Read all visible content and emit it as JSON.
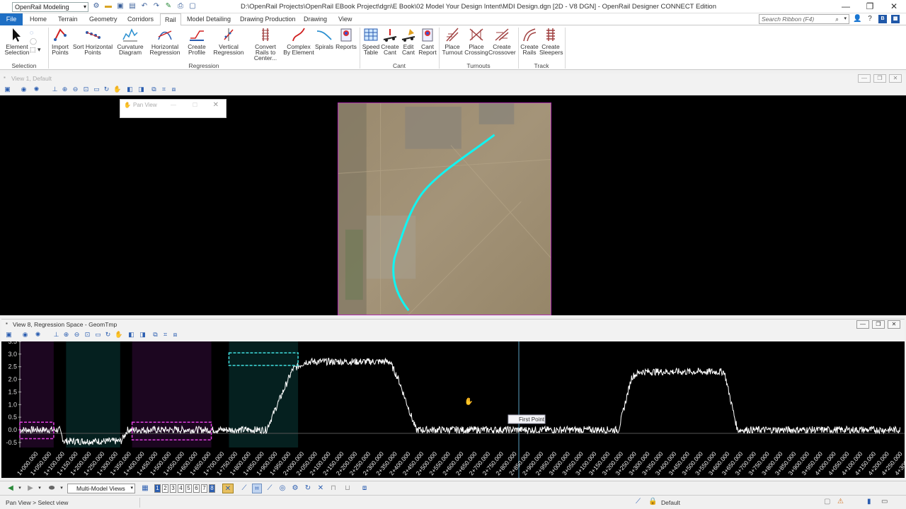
{
  "app": {
    "workspace": "OpenRail Modeling",
    "title": "D:\\OpenRail Projects\\OpenRail EBook Project\\dgn\\E Book\\02 Model Your Design Intent\\MDI Design.dgn [2D - V8 DGN] - OpenRail Designer CONNECT Edition",
    "search_placeholder": "Search Ribbon (F4)"
  },
  "tabs": [
    "File",
    "Home",
    "Terrain",
    "Geometry",
    "Corridors",
    "Rail",
    "Model Detailing",
    "Drawing Production",
    "Drawing",
    "View"
  ],
  "active_tab": "Rail",
  "ribbon": {
    "selection": {
      "label": "Selection",
      "element_selection": "Element Selection"
    },
    "regression": {
      "label": "Regression",
      "import_points": "Import Points",
      "sort_points": "Sort Horizontal Points",
      "curvature_diagram": "Curvature Diagram",
      "horizontal_regression": "Horizontal Regression",
      "create_profile": "Create Profile",
      "vertical_regression": "Vertical Regression",
      "convert_rails": "Convert Rails to Center...",
      "complex_by_element": "Complex By Element",
      "spirals": "Spirals",
      "reports": "Reports"
    },
    "cant": {
      "label": "Cant",
      "speed_table": "Speed Table",
      "create_cant": "Create Cant",
      "edit_cant": "Edit Cant",
      "cant_report": "Cant Report"
    },
    "turnouts": {
      "label": "Turnouts",
      "place_turnout": "Place Turnout",
      "place_crossing": "Place Crossing",
      "create_crossover": "Create Crossover"
    },
    "track": {
      "label": "Track",
      "create_rails": "Create Rails",
      "create_sleepers": "Create Sleepers"
    }
  },
  "view1": {
    "title": "View 1, Default",
    "pan_view_title": "Pan View"
  },
  "view8": {
    "title": "View 8, Regression Space - GeomTmp",
    "first_point_label": "First Point"
  },
  "chart_data": {
    "type": "line",
    "title": "",
    "xlabel": "",
    "ylabel": "",
    "y_ticks": [
      "3.5",
      "3.0",
      "2.5",
      "2.0",
      "1.5",
      "1.0",
      "0.5",
      "0.0",
      "-0.5"
    ],
    "ylim": [
      -0.7,
      3.5
    ],
    "x_tick_labels": [
      "1+000.000",
      "1+050.000",
      "1+100.000",
      "1+150.000",
      "1+200.000",
      "1+250.000",
      "1+300.000",
      "1+350.000",
      "1+400.000",
      "1+450.000",
      "1+500.000",
      "1+550.000",
      "1+600.000",
      "1+650.000",
      "1+700.000",
      "1+750.000",
      "1+800.000",
      "1+850.000",
      "1+900.000",
      "1+950.000",
      "2+000.000",
      "2+050.000",
      "2+100.000",
      "2+150.000",
      "2+200.000",
      "2+250.000",
      "2+300.000",
      "2+350.000",
      "2+400.000",
      "2+450.000",
      "2+500.000",
      "2+550.000",
      "2+600.000",
      "2+650.000",
      "2+700.000",
      "2+750.000",
      "2+800.000",
      "2+850.000",
      "2+900.000",
      "2+950.000",
      "3+000.000",
      "3+050.000",
      "3+100.000",
      "3+150.000",
      "3+200.000",
      "3+250.000",
      "3+300.000",
      "3+350.000",
      "3+400.000",
      "3+450.000",
      "3+500.000",
      "3+550.000",
      "3+600.000",
      "3+650.000",
      "3+700.000",
      "3+750.000",
      "3+800.000",
      "3+850.000",
      "3+900.000",
      "3+950.000",
      "4+000.000",
      "4+050.000",
      "4+100.000",
      "4+150.000",
      "4+200.000",
      "4+250.000",
      "4+300.000"
    ],
    "curve_profile": [
      [
        1000,
        0.0
      ],
      [
        1090,
        0.0
      ],
      [
        1100,
        -0.45
      ],
      [
        1230,
        -0.45
      ],
      [
        1245,
        0.0
      ],
      [
        1560,
        0.0
      ],
      [
        1620,
        2.4
      ],
      [
        1650,
        2.7
      ],
      [
        1840,
        2.7
      ],
      [
        1860,
        2.0
      ],
      [
        1900,
        0.0
      ],
      [
        2360,
        0.0
      ],
      [
        2390,
        2.1
      ],
      [
        2410,
        2.3
      ],
      [
        2600,
        2.3
      ],
      [
        2630,
        0.0
      ],
      [
        3000,
        0.0
      ]
    ],
    "regions": [
      {
        "x0": 1000,
        "x1": 1077,
        "kind": "magenta"
      },
      {
        "x0": 1105,
        "x1": 1228,
        "kind": "cyan"
      },
      {
        "x0": 1255,
        "x1": 1435,
        "kind": "magenta"
      },
      {
        "x0": 1475,
        "x1": 1632,
        "kind": "cyan"
      }
    ],
    "boxes": [
      {
        "x0": 1000,
        "x1": 1077,
        "y0": -0.35,
        "y1": 0.3,
        "color": "#e040e0"
      },
      {
        "x0": 1255,
        "x1": 1435,
        "y0": -0.4,
        "y1": 0.3,
        "color": "#e040e0"
      },
      {
        "x0": 1475,
        "x1": 1632,
        "y0": 2.55,
        "y1": 3.05,
        "color": "#40e0e0"
      }
    ],
    "grid": false,
    "legend": "none"
  }
}
